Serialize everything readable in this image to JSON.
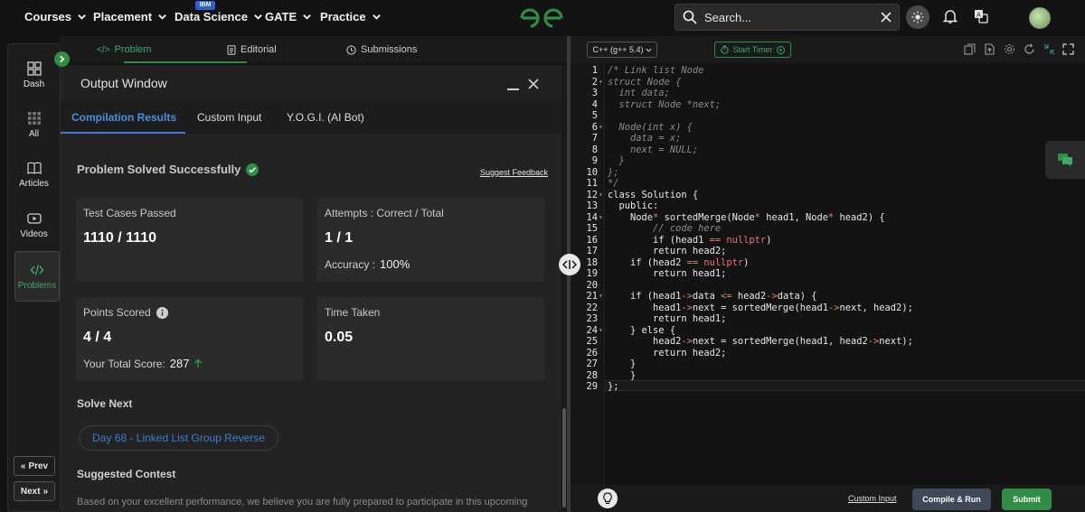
{
  "nav": {
    "items": [
      "Courses",
      "Placement",
      "Data Science",
      "GATE",
      "Practice"
    ],
    "badge": "IBM",
    "search_placeholder": "Search..."
  },
  "rail": {
    "items": [
      "Dash",
      "All",
      "Articles",
      "Videos",
      "Problems"
    ],
    "prev": "Prev",
    "next": "Next"
  },
  "problem_tabs": [
    "Problem",
    "Editorial",
    "Submissions"
  ],
  "output": {
    "title": "Output Window",
    "tabs": [
      "Compilation Results",
      "Custom Input",
      "Y.O.G.I. (AI Bot)"
    ],
    "status": "Problem Solved Successfully",
    "feedback": "Suggest Feedback",
    "cards": {
      "test_label": "Test Cases Passed",
      "test_value": "1110 / 1110",
      "attempts_label": "Attempts : Correct / Total",
      "attempts_value": "1 / 1",
      "accuracy_label": "Accuracy :",
      "accuracy_value": "100%",
      "points_label": "Points Scored",
      "points_value": "4 / 4",
      "total_label": "Your Total Score:",
      "total_value": "287",
      "time_label": "Time Taken",
      "time_value": "0.05"
    },
    "solve_next_title": "Solve Next",
    "solve_next_item": "Day 68 - Linked List Group Reverse",
    "suggested_contest_title": "Suggested Contest",
    "contest_text": "Based on your excellent performance, we believe you are fully prepared to participate in this upcoming"
  },
  "editor": {
    "language": "C++ (g++ 5.4)",
    "timer": "Start Timer",
    "footer": {
      "custom_input": "Custom Input",
      "compile": "Compile & Run",
      "submit": "Submit"
    },
    "lines": [
      "/* Link list Node",
      "struct Node {",
      "  int data;",
      "  struct Node *next;",
      "",
      "  Node(int x) {",
      "    data = x;",
      "    next = NULL;",
      "  }",
      "};",
      "*/",
      "class Solution {",
      "  public:",
      "    Node* sortedMerge(Node* head1, Node* head2) {",
      "        // code here",
      "        if (head1 == nullptr)",
      "        return head2;",
      "    if (head2 == nullptr)",
      "        return head1;",
      "",
      "    if (head1->data <= head2->data) {",
      "        head1->next = sortedMerge(head1->next, head2);",
      "        return head1;",
      "    } else {",
      "        head2->next = sortedMerge(head1, head2->next);",
      "        return head2;",
      "    }",
      "    }",
      "};"
    ]
  }
}
